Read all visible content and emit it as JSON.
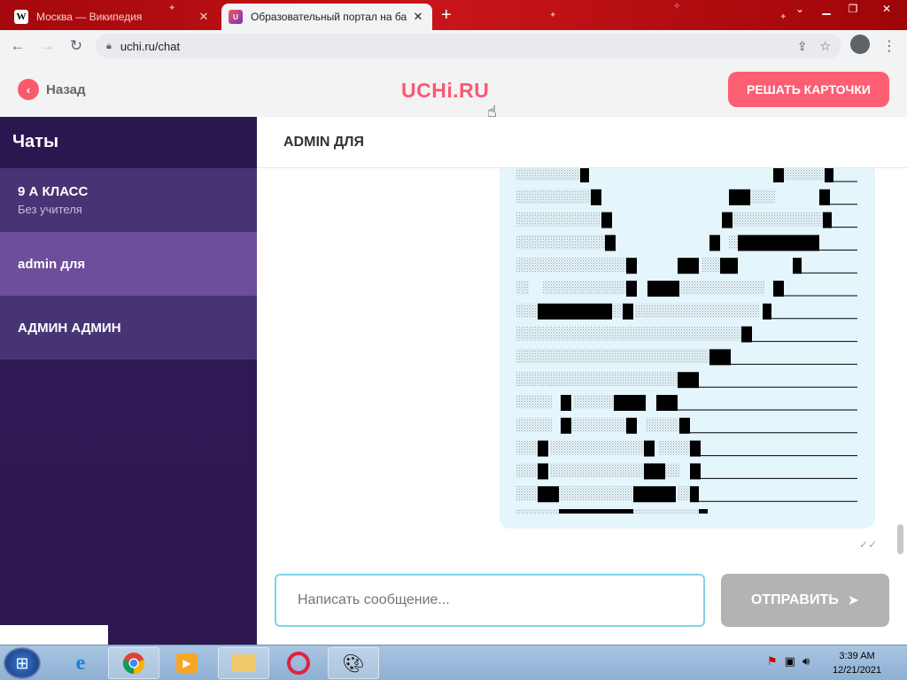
{
  "browser": {
    "tabs": [
      {
        "label": "Москва — Википедия",
        "favicon": "W",
        "active": false
      },
      {
        "label": "Образовательный портал на ба",
        "favicon": "U",
        "active": true
      }
    ],
    "new_tab": "+",
    "url": "uchi.ru/chat"
  },
  "header": {
    "back_label": "Назад",
    "logo": "UCHi.RU",
    "cards_button": "РЕШАТЬ КАРТОЧКИ"
  },
  "sidebar": {
    "title": "Чаты",
    "items": [
      {
        "name": "9 А КЛАСС",
        "sub": "Без учителя"
      },
      {
        "name": "admin для",
        "sub": ""
      },
      {
        "name": "АДМИН АДМИН",
        "sub": ""
      }
    ]
  },
  "chat": {
    "title": "ADMIN ДЛЯ",
    "read_ticks": "✓✓"
  },
  "composer": {
    "placeholder": "Написать сообщение...",
    "send_label": "ОТПРАВИТЬ",
    "send_icon": "➤"
  },
  "taskbar": {
    "time": "3:39 AM",
    "date": "12/21/2021"
  },
  "colors": {
    "brand": "#fc5871",
    "sidebar_bg": "#301a59",
    "sidebar_active": "#6e4d9b",
    "input_border": "#7fd3e8",
    "send_disabled": "#b3b3b3"
  }
}
